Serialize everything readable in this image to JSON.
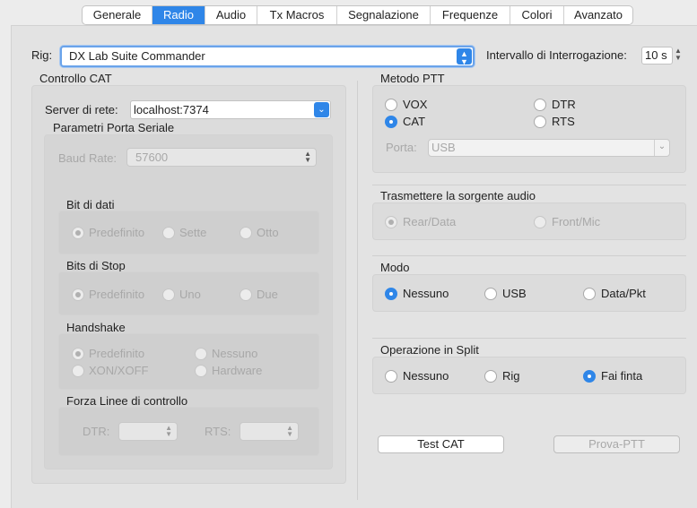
{
  "tabs": [
    "Generale",
    "Radio",
    "Audio",
    "Tx Macros",
    "Segnalazione",
    "Frequenze",
    "Colori",
    "Avanzato"
  ],
  "active_tab": "Radio",
  "rig": {
    "label": "Rig:",
    "value": "DX Lab Suite Commander"
  },
  "interval": {
    "label": "Intervallo di Interrogazione:",
    "value": "10 s"
  },
  "cat": {
    "title": "Controllo CAT",
    "server_label": "Server di rete:",
    "server_value": "localhost:7374",
    "serial_title": "Parametri Porta Seriale",
    "baud_label": "Baud Rate:",
    "baud_value": "57600",
    "data_bits": {
      "title": "Bit di dati",
      "options": [
        "Predefinito",
        "Sette",
        "Otto"
      ]
    },
    "stop_bits": {
      "title": "Bits di Stop",
      "options": [
        "Predefinito",
        "Uno",
        "Due"
      ]
    },
    "handshake": {
      "title": "Handshake",
      "options": [
        "Predefinito",
        "Nessuno",
        "XON/XOFF",
        "Hardware"
      ]
    },
    "force_lines": {
      "title": "Forza Linee di controllo",
      "dtr_label": "DTR:",
      "rts_label": "RTS:"
    }
  },
  "ptt": {
    "title": "Metodo PTT",
    "options": [
      "VOX",
      "DTR",
      "CAT",
      "RTS"
    ],
    "selected": "CAT",
    "port_label": "Porta:",
    "port_value": "USB"
  },
  "audio_source": {
    "title": "Trasmettere la sorgente audio",
    "options": [
      "Rear/Data",
      "Front/Mic"
    ]
  },
  "mode": {
    "title": "Modo",
    "options": [
      "Nessuno",
      "USB",
      "Data/Pkt"
    ],
    "selected": "Nessuno"
  },
  "split": {
    "title": "Operazione in Split",
    "options": [
      "Nessuno",
      "Rig",
      "Fai finta"
    ],
    "selected": "Fai finta"
  },
  "buttons": {
    "test_cat": "Test CAT",
    "test_ptt": "Prova-PTT"
  },
  "colors": {
    "accent": "#2f86e8"
  }
}
